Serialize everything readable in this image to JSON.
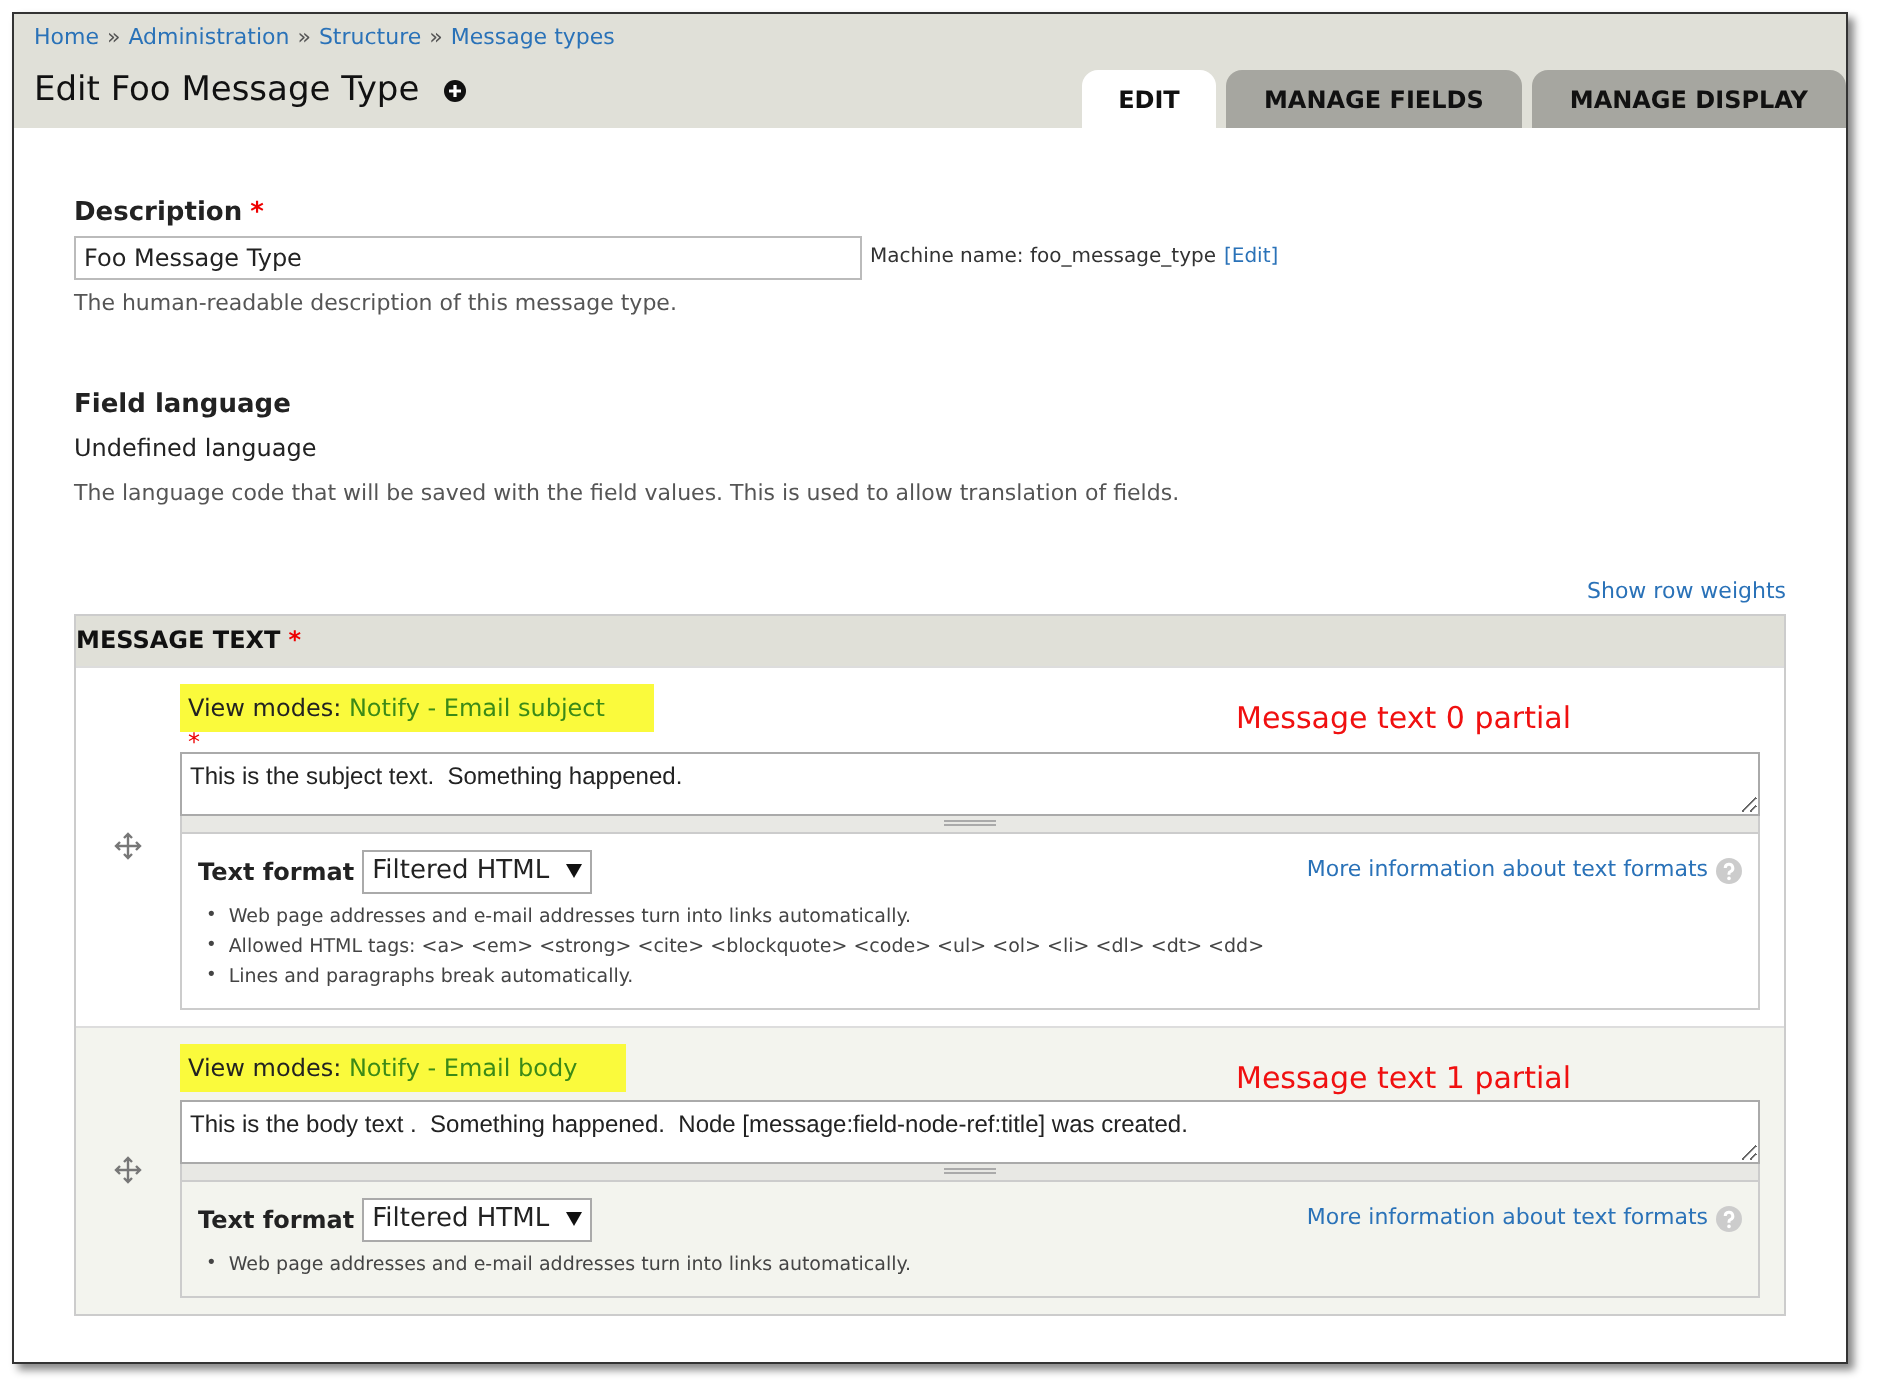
{
  "breadcrumb": [
    {
      "label": "Home"
    },
    {
      "label": "Administration"
    },
    {
      "label": "Structure"
    },
    {
      "label": "Message types"
    }
  ],
  "breadcrumb_separator": "»",
  "required_mark": "*",
  "bullet": "•",
  "title": "Edit Foo Message Type",
  "tabs": [
    {
      "label": "EDIT",
      "selected": true
    },
    {
      "label": "MANAGE FIELDS",
      "selected": false
    },
    {
      "label": "MANAGE DISPLAY",
      "selected": false
    }
  ],
  "description": {
    "label": "Description",
    "required": true,
    "value": "Foo Message Type",
    "machine_name_label": "Machine name: foo_message_type",
    "edit_link": "[Edit]",
    "help": "The human-readable description of this message type."
  },
  "field_language": {
    "label": "Field language",
    "value": "Undefined language",
    "help": "The language code that will be saved with the field values. This is used to allow translation of fields."
  },
  "show_row_weights": "Show row weights",
  "message_text": {
    "header": "MESSAGE TEXT",
    "required": true,
    "rows": [
      {
        "view_modes_label": "View modes:",
        "view_modes_value": "Notify - Email subject",
        "required": true,
        "value": "This is the subject text.  Something happened.",
        "annotation": "Message text 0 partial",
        "format_label": "Text format",
        "format_value": "Filtered HTML",
        "more_info": "More information about text formats",
        "tips": [
          "Web page addresses and e-mail addresses turn into links automatically.",
          "Allowed HTML tags: <a> <em> <strong> <cite> <blockquote> <code> <ul> <ol> <li> <dl> <dt> <dd>",
          "Lines and paragraphs break automatically."
        ]
      },
      {
        "view_modes_label": "View modes:",
        "view_modes_value": "Notify - Email body",
        "required": false,
        "value": "This is the body text .  Something happened.  Node [message:field-node-ref:title] was created.",
        "annotation": "Message text 1 partial",
        "format_label": "Text format",
        "format_value": "Filtered HTML",
        "more_info": "More information about text formats",
        "tips": [
          "Web page addresses and e-mail addresses turn into links automatically."
        ]
      }
    ]
  }
}
